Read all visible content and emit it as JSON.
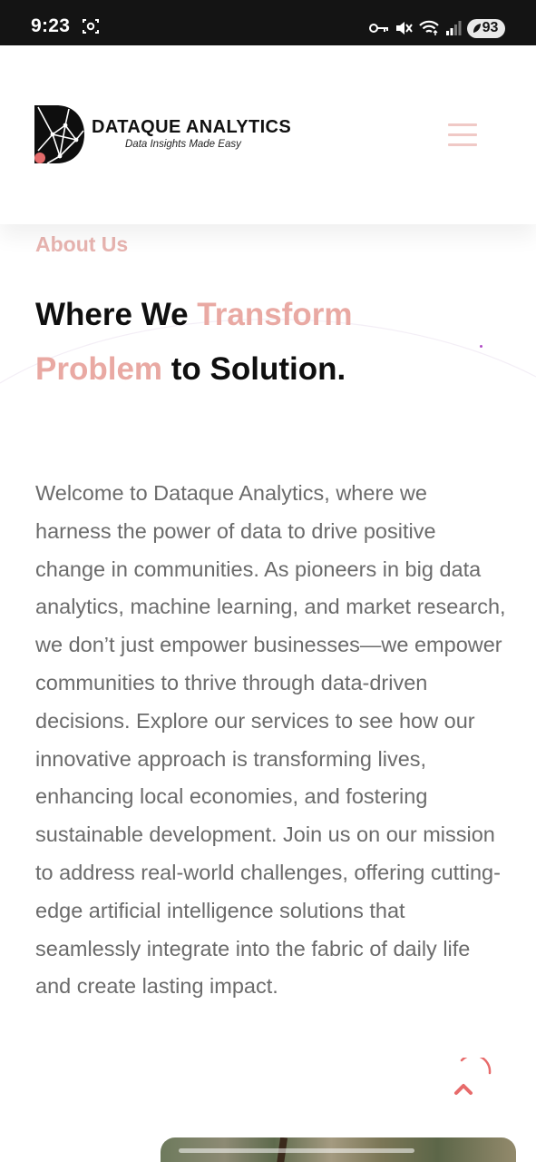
{
  "status_bar": {
    "time": "9:23",
    "battery": "93",
    "icons": [
      "screen-record-icon",
      "key-icon",
      "mute-icon",
      "wifi-icon",
      "signal-icon",
      "battery-icon"
    ]
  },
  "header": {
    "brand_name": "DATAQUE ANALYTICS",
    "tagline": "Data Insights Made Easy",
    "menu_icon": "hamburger-menu-icon"
  },
  "about": {
    "label": "About Us",
    "headline": {
      "part1": "Where We ",
      "accent1": "Transform",
      "accent2": "Problem",
      "part2": " to Solution."
    },
    "body": "Welcome to Dataque Analytics, where we harness the power of data to drive positive change in communities. As pioneers in big data analytics, machine learning, and market research, we don’t just empower businesses—we empower communities to thrive through data-driven decisions. Explore our services to see how our innovative approach is transforming lives, enhancing local economies, and fostering sustainable development. Join us on our mission to address real-world challenges, offering cutting-edge artificial intelligence solutions that seamlessly integrate into the fabric of daily life and create lasting impact."
  },
  "colors": {
    "accent": "#e9a9a3",
    "label": "#e8b4b0",
    "body_text": "#6b6b6b",
    "heading": "#0f0f0f",
    "status_bar": "#141414"
  }
}
